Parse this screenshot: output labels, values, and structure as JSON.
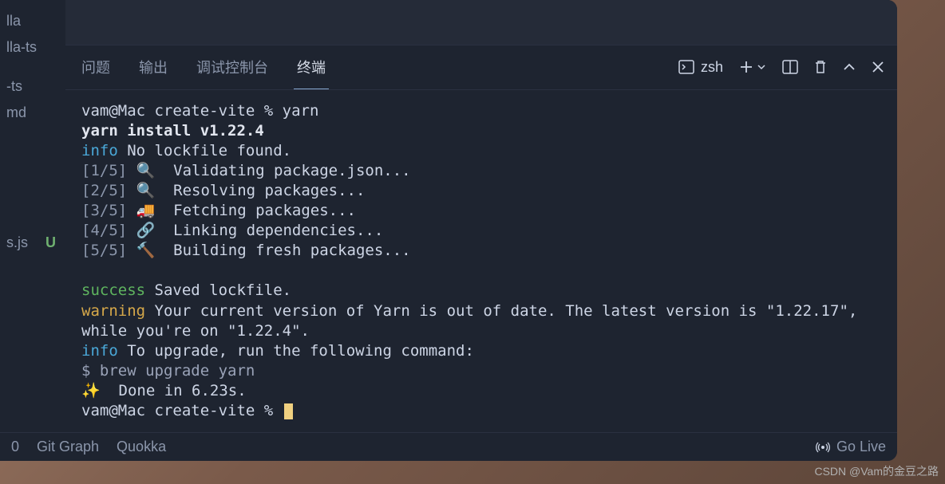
{
  "sidebar": {
    "items": [
      {
        "label": "lla"
      },
      {
        "label": "lla-ts"
      },
      {
        "label": ""
      },
      {
        "label": "-ts"
      },
      {
        "label": "md"
      },
      {
        "label": ""
      },
      {
        "label": ""
      },
      {
        "label": "s.js",
        "status": "U"
      }
    ]
  },
  "panel": {
    "tabs": [
      {
        "label": "问题"
      },
      {
        "label": "输出"
      },
      {
        "label": "调试控制台"
      },
      {
        "label": "终端"
      }
    ],
    "active_tab_index": 3,
    "shell": "zsh"
  },
  "terminal": {
    "prompt1": "vam@Mac create-vite % yarn",
    "yarn_line": "yarn install v1.22.4",
    "info_label": "info",
    "no_lockfile": " No lockfile found.",
    "step1_prefix": "[1/5] 🔍  ",
    "step1_text": "Validating package.json...",
    "step2_prefix": "[2/5] 🔍  ",
    "step2_text": "Resolving packages...",
    "step3_prefix": "[3/5] 🚚  ",
    "step3_text": "Fetching packages...",
    "step4_prefix": "[4/5] 🔗  ",
    "step4_text": "Linking dependencies...",
    "step5_prefix": "[5/5] 🔨  ",
    "step5_text": "Building fresh packages...",
    "success_label": "success",
    "saved_lockfile": " Saved lockfile.",
    "warning_label": "warning",
    "warning_text": " Your current version of Yarn is out of date. The latest version is \"1.22.17\", while you're on \"1.22.4\".",
    "info2_text": " To upgrade, run the following command:",
    "brew_cmd": "$ brew upgrade yarn",
    "done_line": "✨  Done in 6.23s.",
    "prompt2": "vam@Mac create-vite % "
  },
  "statusbar": {
    "item0": "0",
    "git_graph": "Git Graph",
    "quokka": "Quokka",
    "go_live": "Go Live"
  },
  "watermark": "CSDN @Vam的金豆之路"
}
